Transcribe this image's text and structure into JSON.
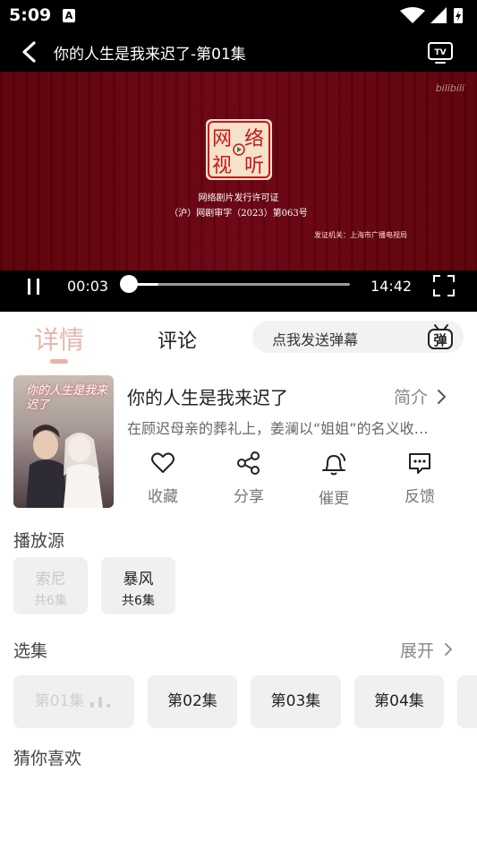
{
  "status_bar": {
    "time": "5:09",
    "notification_glyph": "A"
  },
  "header": {
    "title": "你的人生是我来迟了-第01集"
  },
  "video": {
    "watermark": "bilibili",
    "seal_chars": [
      "网",
      "络",
      "视",
      "听"
    ],
    "license_line1": "网络剧片发行许可证",
    "license_line2": "（沪）网剧审字（2023）第063号",
    "issuer": "发证机关：上海市广播电视局"
  },
  "player": {
    "current_time": "00:03",
    "duration": "14:42",
    "progress": 0.0034
  },
  "tabs": {
    "details": "详情",
    "comments": "评论"
  },
  "danmaku": {
    "placeholder": "点我发送弹幕",
    "icon_char": "弹"
  },
  "drama": {
    "poster_title": "你的人生是我来迟了",
    "name": "你的人生是我来迟了",
    "intro_label": "简介",
    "synopsis": "在顾迟母亲的葬礼上，姜澜以“姐姐”的名义收…"
  },
  "actions": [
    {
      "label": "收藏",
      "icon": "heart-icon"
    },
    {
      "label": "分享",
      "icon": "share-icon"
    },
    {
      "label": "催更",
      "icon": "bell-icon"
    },
    {
      "label": "反馈",
      "icon": "feedback-icon"
    }
  ],
  "sources": {
    "title": "播放源",
    "items": [
      {
        "name": "索尼",
        "count": "共6集",
        "active": true
      },
      {
        "name": "暴风",
        "count": "共6集",
        "active": false
      }
    ]
  },
  "episodes": {
    "title": "选集",
    "expand_label": "展开",
    "items": [
      {
        "label": "第01集",
        "active": true
      },
      {
        "label": "第02集",
        "active": false
      },
      {
        "label": "第03集",
        "active": false
      },
      {
        "label": "第04集",
        "active": false
      }
    ]
  },
  "recommend": {
    "title": "猜你喜欢"
  },
  "colors": {
    "accent": "#e6b6ab",
    "video_bg": "#5c0109",
    "seal_red": "#c8161e"
  }
}
